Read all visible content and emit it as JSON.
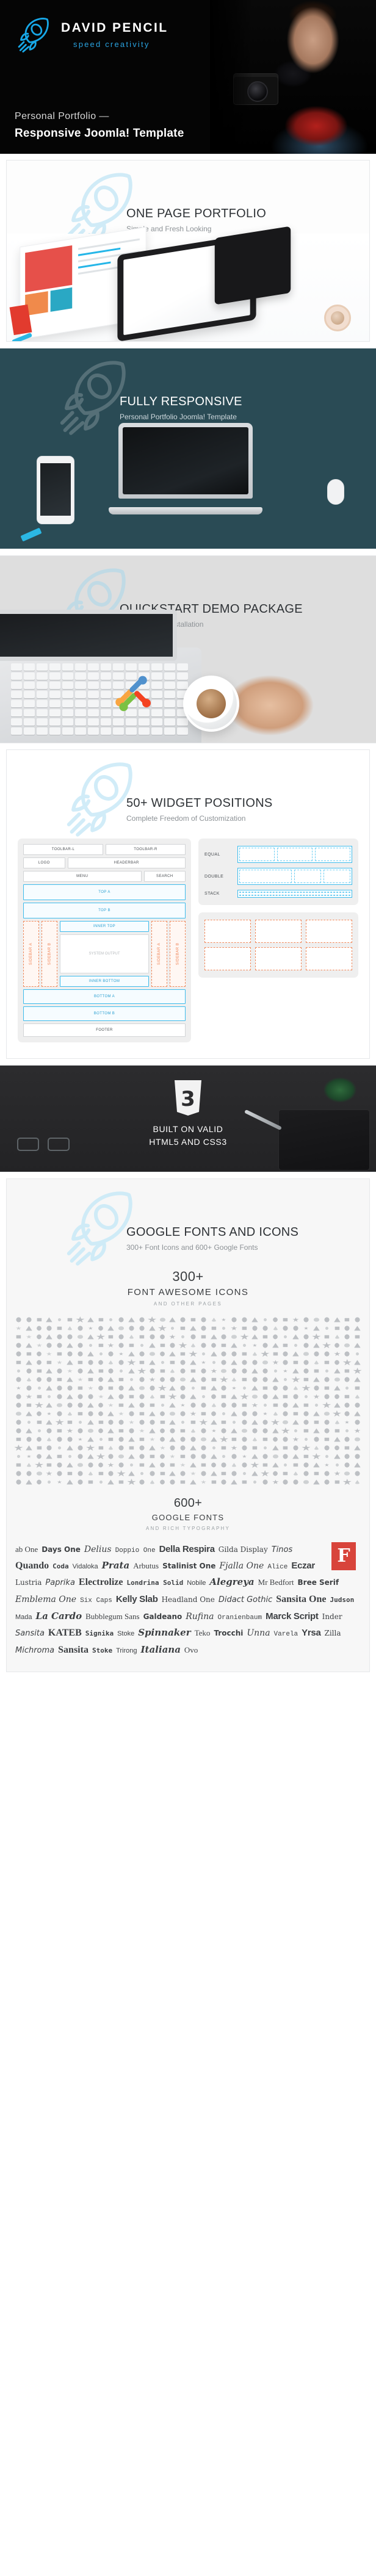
{
  "hero": {
    "brand_name": "DAVID PENCIL",
    "brand_tagline": "speed creativity",
    "subtitle": "Personal Portfolio —",
    "title": "Responsive  Joomla! Template",
    "accent_color": "#2aa3e0",
    "background_color": "#050505",
    "rocket_icon": "rocket-icon",
    "photo_icon": "photographer-photo"
  },
  "sections": [
    {
      "id": "one-page-portfolio",
      "title": "ONE PAGE PORTFOLIO",
      "subtitle": "Simple and Fresh Looking",
      "icon": "rocket-icon",
      "background_color": "#fdfdfd"
    },
    {
      "id": "fully-responsive",
      "title": "FULLY RESPONSIVE",
      "subtitle": "Personal Portfolio Joomla! Template",
      "icon": "rocket-icon",
      "background_color": "#2a4b55"
    },
    {
      "id": "quickstart-demo-package",
      "title": "QUICKSTART DEMO PACKAGE",
      "subtitle": "Fast and Easy Installation",
      "icon": "rocket-icon",
      "background_color": "#dedede"
    },
    {
      "id": "widget-positions",
      "title": "50+ WIDGET POSITIONS",
      "subtitle": "Complete Freedom of Customization",
      "icon": "rocket-icon",
      "background_color": "#ffffff"
    }
  ],
  "widget_map": {
    "layout_rows": [
      {
        "cells": [
          {
            "label": "TOOLBAR-L",
            "style": "plain"
          },
          {
            "label": "TOOLBAR-R",
            "style": "plain"
          }
        ]
      },
      {
        "cells": [
          {
            "label": "LOGO",
            "style": "plain",
            "flex": 1
          },
          {
            "label": "HEADERBAR",
            "style": "plain",
            "flex": 3
          }
        ]
      },
      {
        "cells": [
          {
            "label": "MENU",
            "style": "plain",
            "flex": 3
          },
          {
            "label": "SEARCH",
            "style": "plain",
            "flex": 1
          }
        ]
      },
      {
        "cells": [
          {
            "label": "TOP A",
            "style": "blue"
          }
        ]
      },
      {
        "cells": [
          {
            "label": "TOP B",
            "style": "blue"
          }
        ]
      }
    ],
    "sidebars_left": [
      "SIDEBAR A",
      "SIDEBAR B"
    ],
    "sidebars_right": [
      "SIDEBAR A",
      "SIDEBAR B"
    ],
    "inner_top": "INNER TOP",
    "system_output": "SYSTEM OUTPUT",
    "inner_bottom": "INNER BOTTOM",
    "bottom_rows": [
      {
        "label": "BOTTOM A",
        "style": "blue"
      },
      {
        "label": "BOTTOM B",
        "style": "blue"
      },
      {
        "label": "FOOTER",
        "style": "plain"
      }
    ],
    "grid_styles": [
      {
        "label": "EQUAL",
        "slots": 3
      },
      {
        "label": "DOUBLE",
        "slots": 3
      },
      {
        "label": "STACK",
        "slots": 2
      }
    ],
    "card_count": 6
  },
  "html5": {
    "line1": "BUILT ON VALID",
    "line2": "HTML5 AND CSS3",
    "shield_icon": "html5-shield-icon",
    "background_color": "#2c2c2e"
  },
  "fonts_section": {
    "heading": "GOOGLE FONTS AND ICONS",
    "subheading": "300+ Font Icons and 600+ Google Fonts",
    "icons_title": "300+",
    "icons_subtitle": "FONT AWESOME ICONS",
    "icons_note": "AND OTHER PAGES",
    "fonts_title": "600+",
    "fonts_subtitle": "GOOGLE FONTS",
    "fonts_note": "AND RICH TYPOGRAPHY",
    "icon_count": 680,
    "font_badge": "F",
    "font_badge_color": "#d8443b",
    "font_names": [
      "ab One",
      "Days One",
      "Delius",
      "Doppio One",
      "Della Respira",
      "Gilda Display",
      "Tinos",
      "Quando",
      "Coda",
      "Vidaloka",
      "Prata",
      "Arbutus",
      "Stalinist One",
      "Fjalla One",
      "Alice",
      "Eczar",
      "Lustria",
      "Paprika",
      "Electrolize",
      "Londrina Solid",
      "Nobile",
      "Alegreya",
      "Mr Bedfort",
      "Bree Serif",
      "Emblema One",
      "Six Caps",
      "Kelly Slab",
      "Headland One",
      "Didact Gothic",
      "Sansita One",
      "Judson",
      "Mada",
      "La Cardo",
      "Bubblegum Sans",
      "Galdeano",
      "Rufina",
      "Oranienbaum",
      "Marck Script",
      "Inder",
      "Sansita",
      "KATEB",
      "Signika",
      "Stoke",
      "Spinnaker",
      "Teko",
      "Trocchi",
      "Unna",
      "Varela",
      "Yrsa",
      "Zilla",
      "Michroma",
      "Sansita",
      "Stoke",
      "Trirong",
      "Italiana",
      "Ovo"
    ]
  }
}
